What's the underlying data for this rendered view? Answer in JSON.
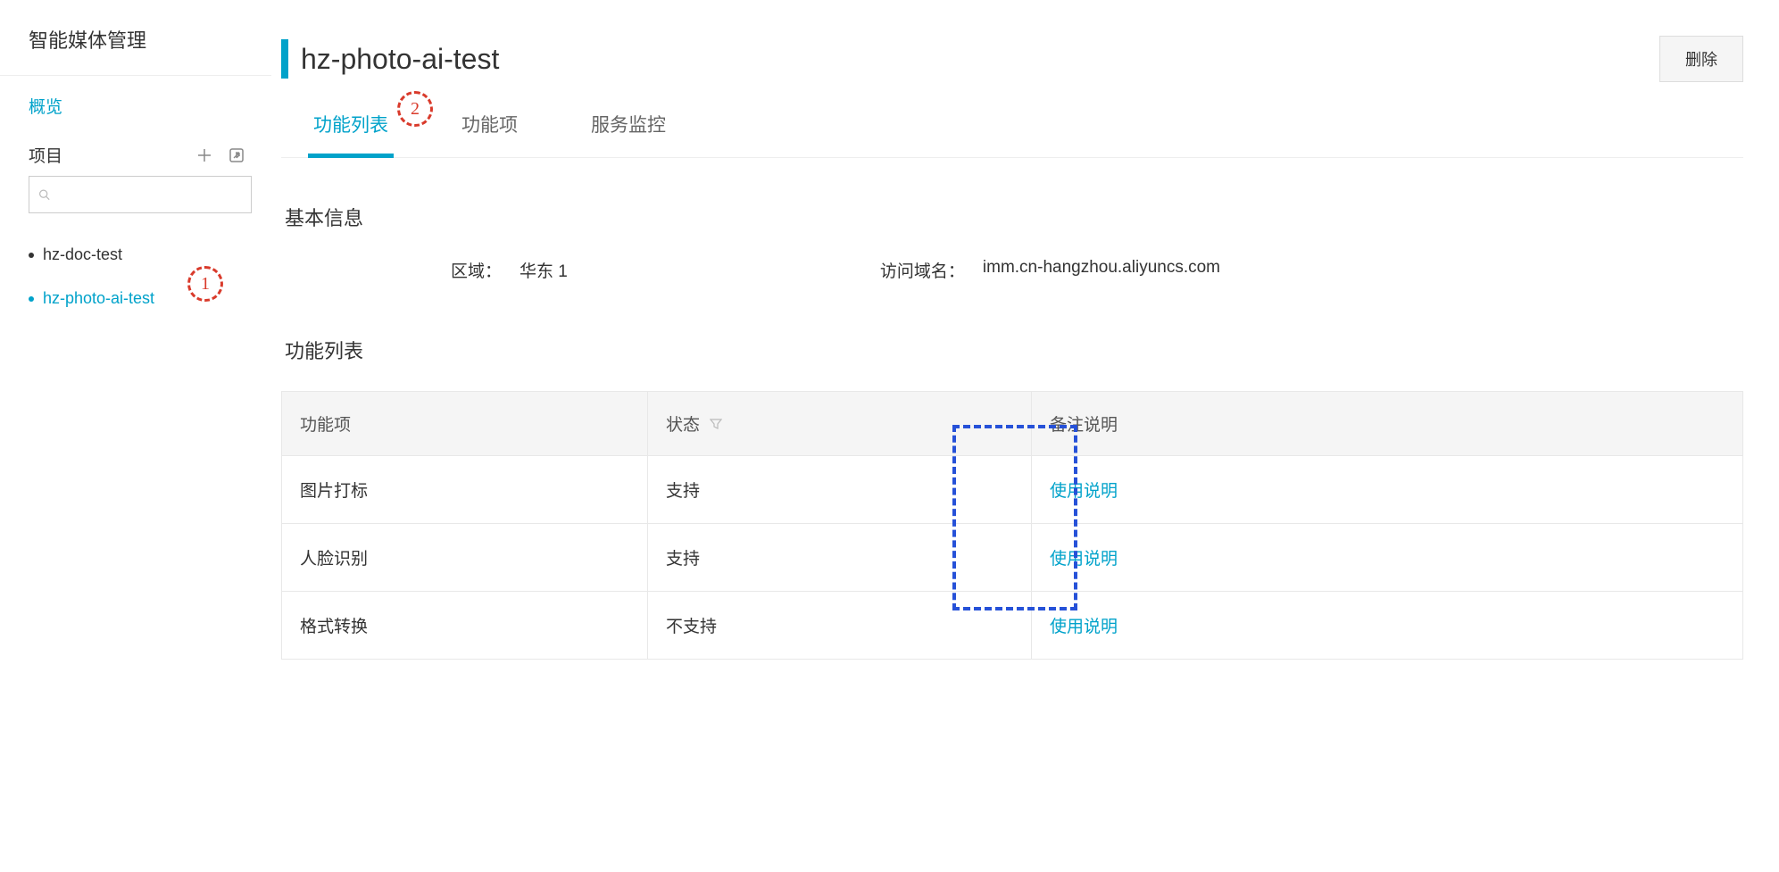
{
  "brand": "智能媒体管理",
  "sidebar": {
    "overview_label": "概览",
    "projects_title": "项目",
    "search_placeholder": "",
    "projects": [
      {
        "name": "hz-doc-test",
        "active": false
      },
      {
        "name": "hz-photo-ai-test",
        "active": true
      }
    ]
  },
  "annotations": {
    "a1": "1",
    "a2": "2"
  },
  "header": {
    "title": "hz-photo-ai-test",
    "delete_label": "删除"
  },
  "tabs": [
    {
      "label": "功能列表",
      "active": true
    },
    {
      "label": "功能项",
      "active": false
    },
    {
      "label": "服务监控",
      "active": false
    }
  ],
  "basic_info": {
    "section_title": "基本信息",
    "region_label": "区域：",
    "region_value": "华东 1",
    "domain_label": "访问域名：",
    "domain_value": "imm.cn-hangzhou.aliyuncs.com"
  },
  "func_list": {
    "section_title": "功能列表",
    "headers": {
      "feature": "功能项",
      "status": "状态",
      "note": "备注说明"
    },
    "rows": [
      {
        "feature": "图片打标",
        "status": "支持",
        "note_link": "使用说明"
      },
      {
        "feature": "人脸识别",
        "status": "支持",
        "note_link": "使用说明"
      },
      {
        "feature": "格式转换",
        "status": "不支持",
        "note_link": "使用说明"
      }
    ]
  }
}
